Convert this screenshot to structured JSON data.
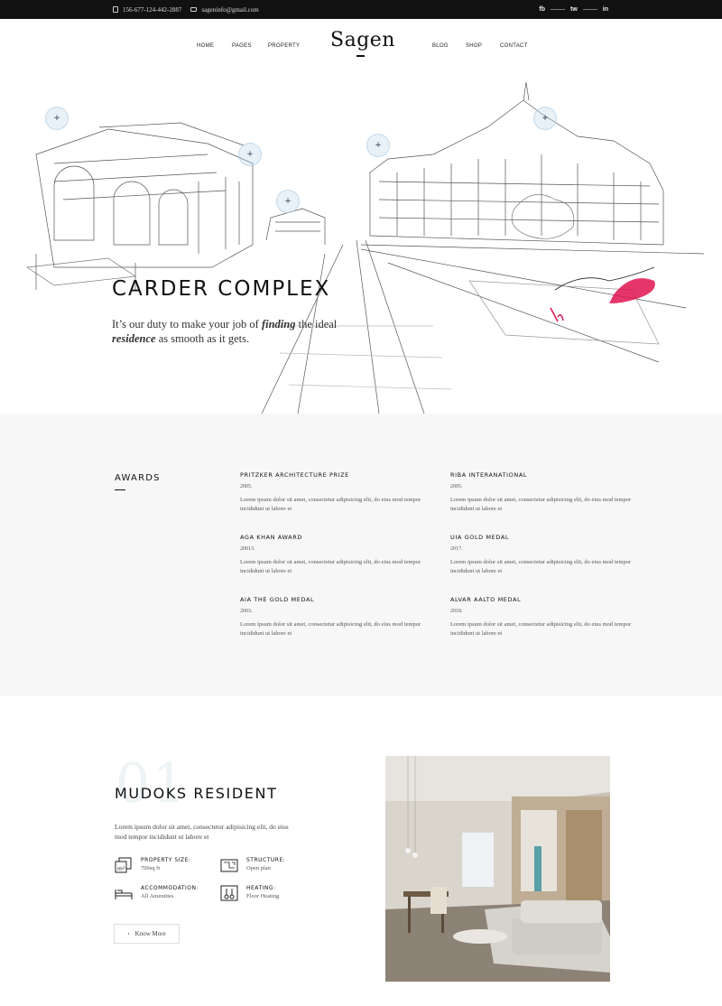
{
  "topbar": {
    "phone": "156-677-124-442-2887",
    "email": "sageninfo@gmail.com",
    "social": [
      "fb",
      "tw",
      "in"
    ]
  },
  "nav": {
    "logo": "Sagen",
    "left_items": [
      "HOME",
      "PAGES",
      "PROPERTY"
    ],
    "right_items": [
      "BLOG",
      "SHOP",
      "CONTACT"
    ]
  },
  "hero": {
    "title": "CARDER COMPLEX",
    "subtitle_parts": [
      "It’s our duty to make your job of ",
      "finding",
      " the ideal ",
      "residence",
      " as smooth as it gets."
    ],
    "hotspot_symbol": "+",
    "signature": "JcPjier"
  },
  "awards": {
    "title": "AWARDS",
    "items": [
      {
        "name": "PRITZKER ARCHITECTURE PRIZE",
        "year": "2005.",
        "desc": "Lorem ipsum dolor sit amet, consectetur adipisicing elit, do eius mod tempor incididunt ut labore et"
      },
      {
        "name": "RIBA INTERANATIONAL",
        "year": "2005.",
        "desc": "Lorem ipsum dolor sit amet, consectetur adipisicing elit, do eius mod tempor incididunt ut labore et"
      },
      {
        "name": "AGA KHAN AWARD",
        "year": "20013.",
        "desc": "Lorem ipsum dolor sit amet, consectetur adipisicing elit, do eius mod tempor incididunt ut labore et"
      },
      {
        "name": "UIA GOLD MEDAL",
        "year": "2017.",
        "desc": "Lorem ipsum dolor sit amet, consectetur adipisicing elit, do eius mod tempor incididunt ut labore et"
      },
      {
        "name": "AIA THE GOLD MEDAL",
        "year": "2003.",
        "desc": "Lorem ipsum dolor sit amet, consectetur adipisicing elit, do eius mod tempor incididunt ut labore et"
      },
      {
        "name": "ALVAR AALTO MEDAL",
        "year": "2018.",
        "desc": "Lorem ipsum dolor sit amet, consectetur adipisicing elit, do eius mod tempor incididunt ut labore et"
      }
    ]
  },
  "property": {
    "number": "01",
    "title": "MUDOKS RESIDENT",
    "desc": "Lorem ipsum dolor sit amet, consectetur adipisicing elit, do eius mod tempor incididunt ut labore et",
    "features": [
      {
        "label": "PROPERTY SIZE:",
        "value": "700sq ft",
        "icon": "area-m2-icon"
      },
      {
        "label": "STRUCTURE:",
        "value": "Open plan",
        "icon": "blueprint-icon"
      },
      {
        "label": "ACCOMMODATION:",
        "value": "All Amenities",
        "icon": "bed-icon"
      },
      {
        "label": "HEATING:",
        "value": "Floor Heating",
        "icon": "thermometer-icon"
      }
    ],
    "button": "Know More"
  },
  "colors": {
    "topbar_bg": "#111111",
    "awards_bg": "#f7f7f7",
    "signature_accent": "#e0134f",
    "hotspot": "#bcd6ea"
  }
}
